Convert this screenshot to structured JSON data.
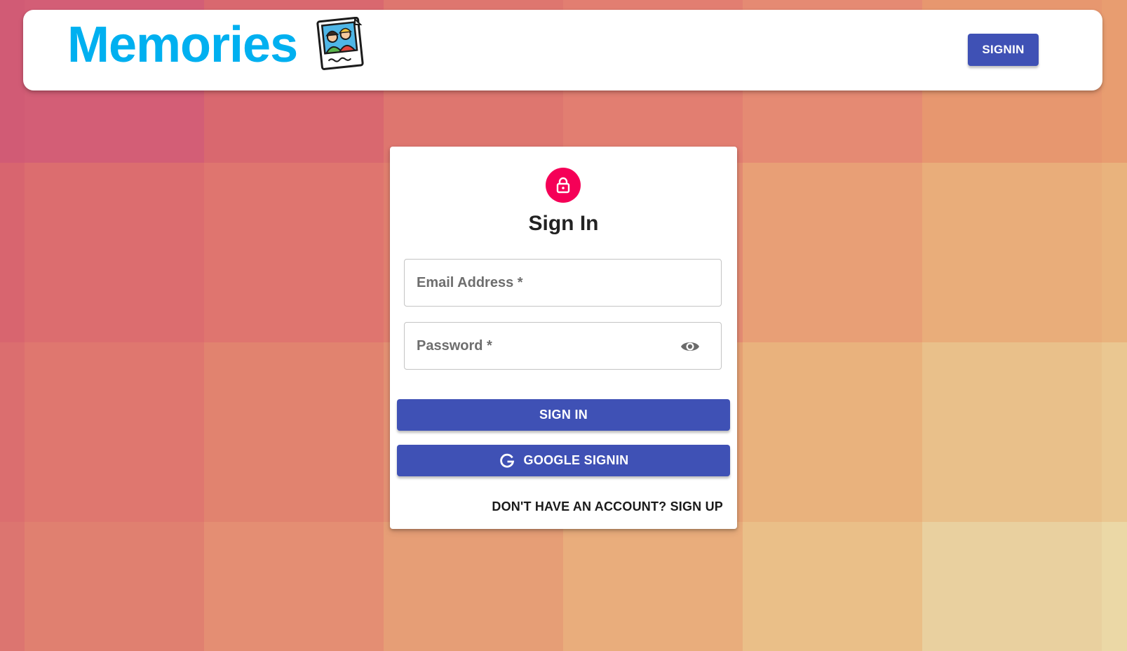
{
  "header": {
    "brand_title": "Memories",
    "logo_icon": "photo-memories-icon",
    "signin_label": "SIGNIN"
  },
  "auth_card": {
    "lock_icon": "lock-icon",
    "title": "Sign In",
    "email": {
      "placeholder": "Email Address *",
      "value": ""
    },
    "password": {
      "placeholder": "Password *",
      "value": "",
      "toggle_icon": "visibility-eye-icon"
    },
    "signin_button_label": "SIGN IN",
    "google_button_label": "GOOGLE SIGNIN",
    "google_icon": "google-g-icon",
    "signup_link_label": "DON'T HAVE AN ACCOUNT? SIGN UP"
  },
  "colors": {
    "brand": "#00b0f0",
    "primary": "#3f51b5",
    "lock_avatar": "#f50057",
    "background_tiles": [
      [
        "#d15b75",
        "#d35e76",
        "#d9686f",
        "#de766f",
        "#e27e71",
        "#e58a73",
        "#e7976f",
        "#e89d70"
      ],
      [
        "#d8656f",
        "#dc6d6f",
        "#df756f",
        "#e2806f",
        "#e58c73",
        "#e89f76",
        "#e9ad7a",
        "#e9b37d"
      ],
      [
        "#db6e6f",
        "#df776f",
        "#e1836f",
        "#e49173",
        "#e7a275",
        "#e9b27d",
        "#e9c08a",
        "#eac791"
      ],
      [
        "#dc7570",
        "#e08070",
        "#e48e73",
        "#e69e76",
        "#e9ad7c",
        "#eabf88",
        "#e9d09f",
        "#ebd8a6"
      ]
    ]
  }
}
